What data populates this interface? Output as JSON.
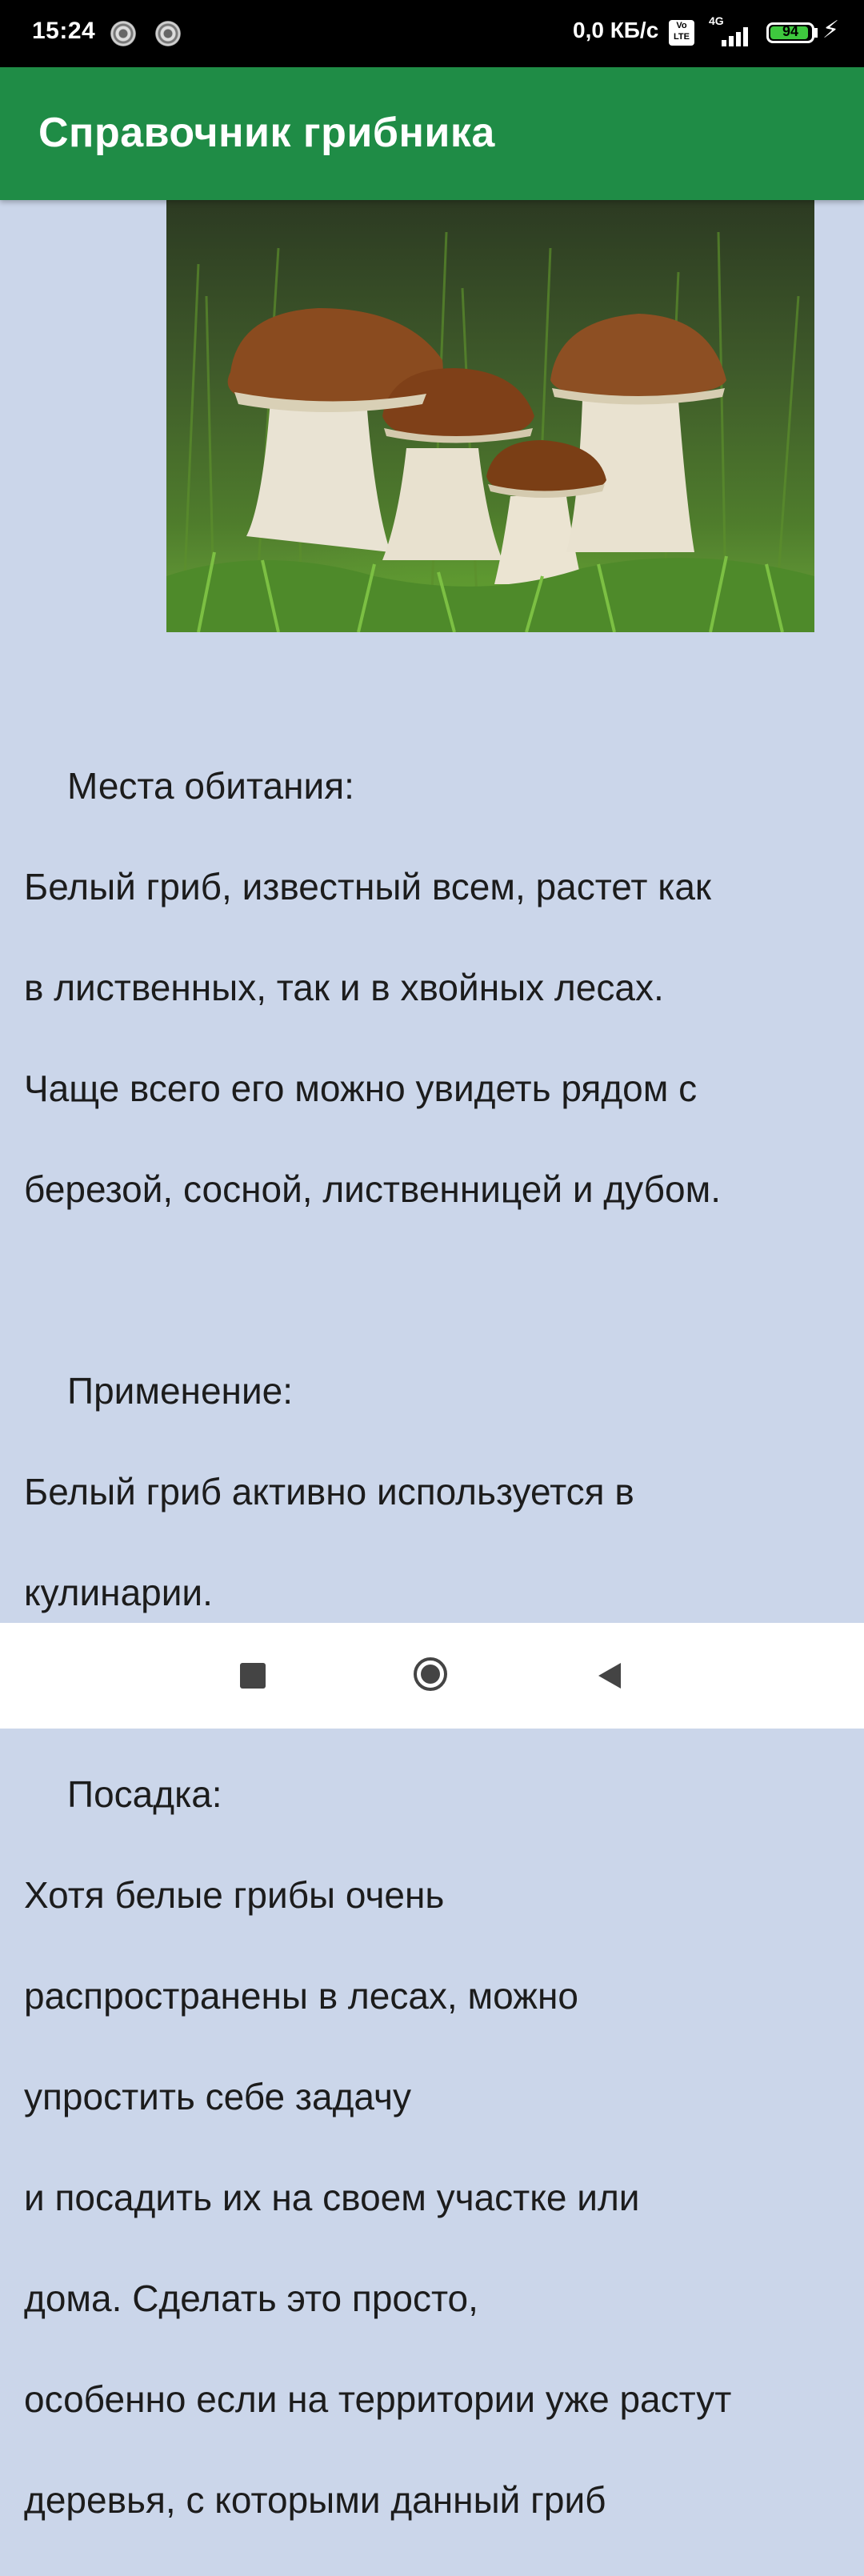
{
  "status_bar": {
    "time": "15:24",
    "network_speed": "0,0 КБ/с",
    "volte_label": "Vo LTE",
    "network_type": "4G",
    "battery_level": 94,
    "battery_text": "94"
  },
  "app_bar": {
    "title": "Справочник грибника"
  },
  "hero_image": {
    "icon": "mushrooms-photo"
  },
  "article": {
    "sections": [
      {
        "heading": "Места обитания:",
        "lines": [
          "Белый гриб, известный всем, растет как",
          "в лиственных, так и в хвойных лесах.",
          "Чаще всего его можно увидеть рядом с",
          "березой, сосной, лиственницей и дубом."
        ]
      },
      {
        "heading": "Применение:",
        "lines": [
          "Белый гриб активно используется в",
          "кулинарии."
        ]
      },
      {
        "heading": "Посадка:",
        "lines": [
          "Хотя белые грибы очень",
          "распространены в лесах, можно",
          "упростить себе задачу",
          "и посадить их на своем участке или",
          "дома. Сделать это просто,",
          "особенно если на территории уже растут",
          "деревья, с которыми данный гриб"
        ]
      }
    ]
  },
  "nav_bar": {
    "recent_icon": "square-icon",
    "home_icon": "circle-icon",
    "back_icon": "triangle-back-icon"
  },
  "colors": {
    "app_bar": "#1f8c46",
    "background": "#cbd6ea",
    "status_bar": "#000000"
  }
}
